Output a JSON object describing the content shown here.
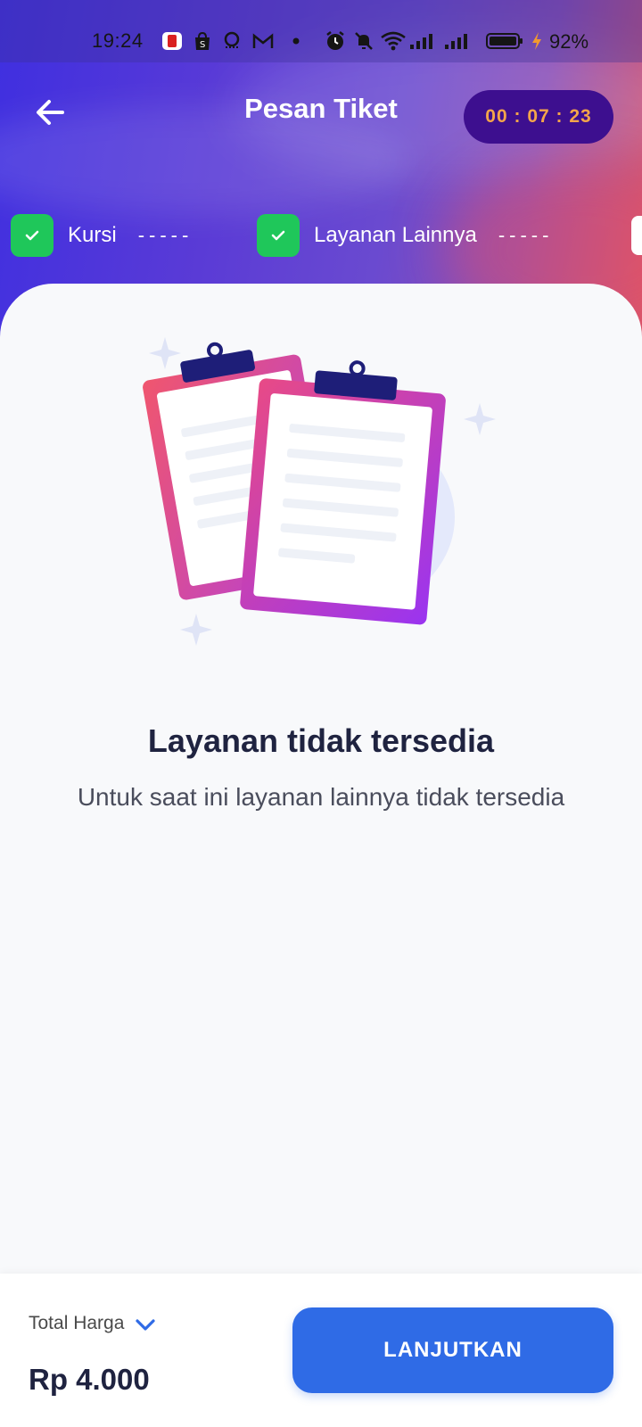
{
  "status_bar": {
    "time": "19:24",
    "battery": "92%",
    "icons": [
      "notification-app-icon",
      "shopping-bag-icon",
      "search-app-icon",
      "gmail-icon",
      "dot-icon",
      "alarm-icon",
      "mute-icon",
      "wifi-icon",
      "signal-icon",
      "signal-icon",
      "battery-icon",
      "charging-icon"
    ]
  },
  "header": {
    "title": "Pesan Tiket",
    "timer": "00 : 07 : 23",
    "back_icon": "arrow-left-icon"
  },
  "steps": [
    {
      "label": "Kursi",
      "dash": "-----",
      "done": true
    },
    {
      "label": "Layanan Lainnya",
      "dash": "-----",
      "done": true
    }
  ],
  "empty_state": {
    "title": "Layanan tidak tersedia",
    "description": "Untuk saat ini layanan lainnya tidak tersedia",
    "illustration": "clipboard-illustration"
  },
  "footer": {
    "total_label": "Total Harga",
    "total_price": "Rp 4.000",
    "continue_label": "LANJUTKAN"
  },
  "colors": {
    "header_start": "#3f2fe0",
    "header_end": "#d9566a",
    "timer_bg": "#3d0f8f",
    "timer_text": "#f4a54a",
    "check_green": "#1fc75a",
    "primary_button": "#2f6be6",
    "title_text": "#1f2340"
  }
}
